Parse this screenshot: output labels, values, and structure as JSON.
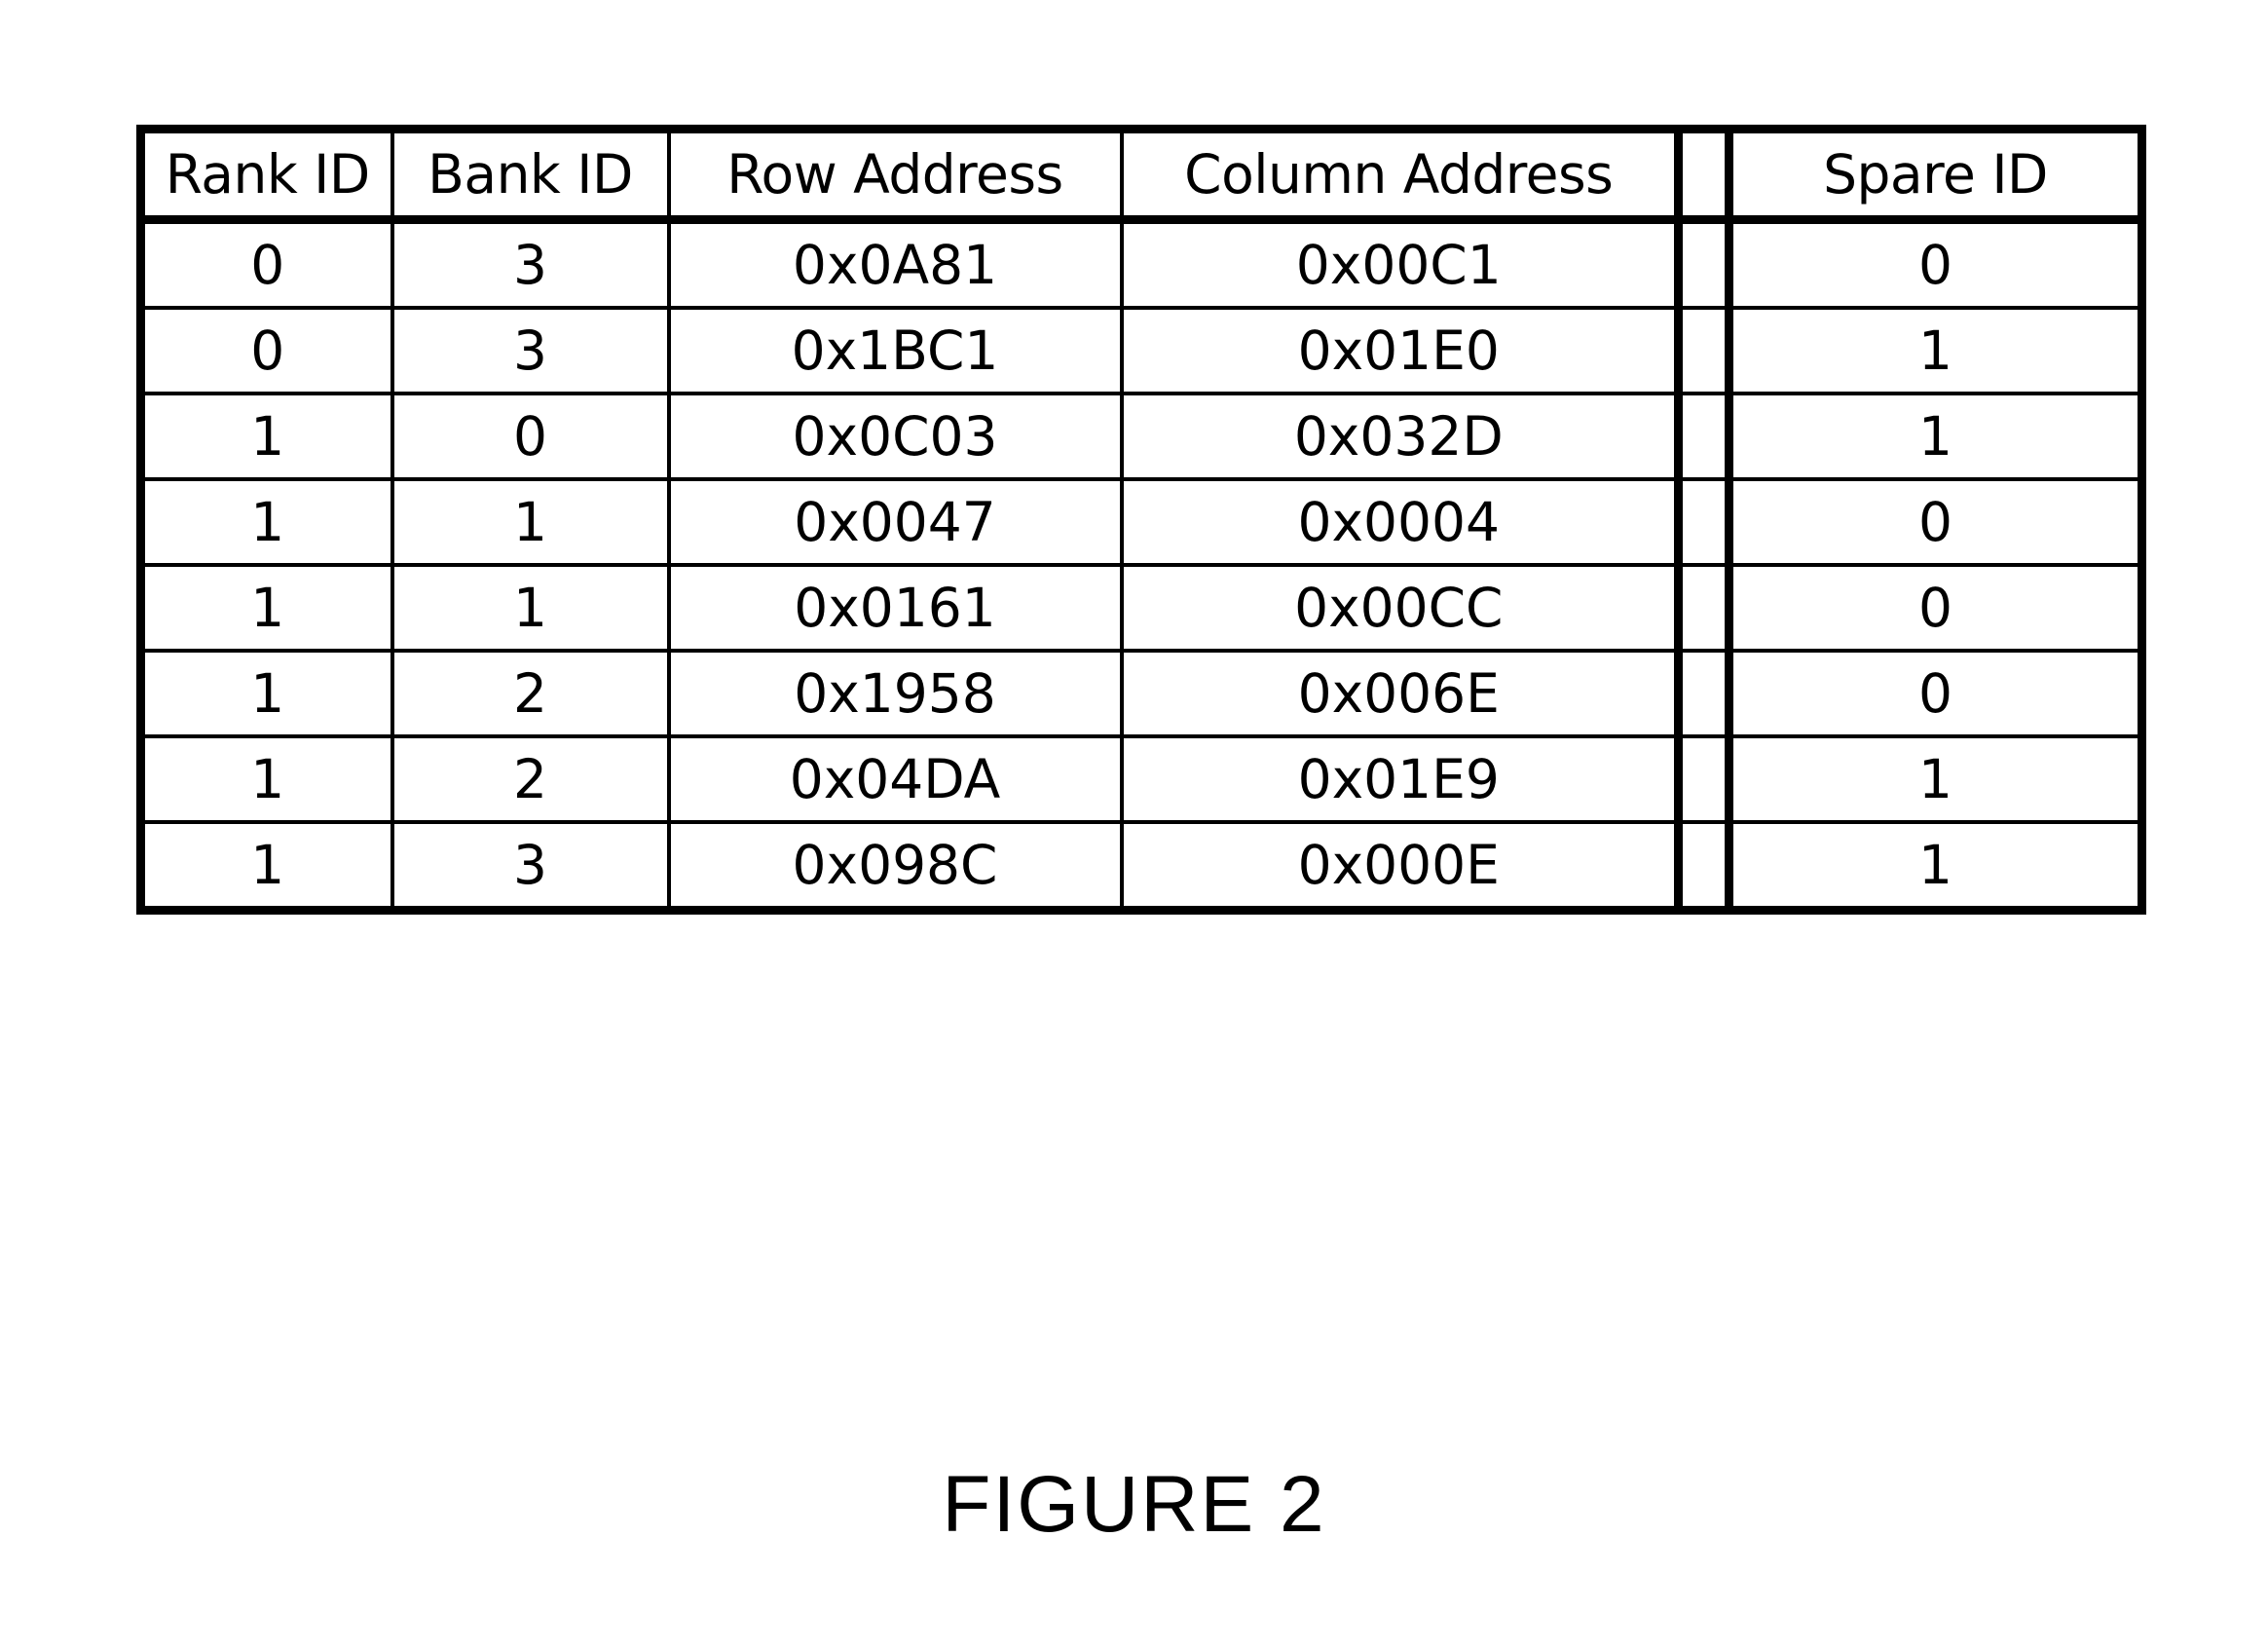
{
  "figure": {
    "caption": "FIGURE 2"
  },
  "table": {
    "headers": {
      "rank_id": "Rank ID",
      "bank_id": "Bank ID",
      "row_address": "Row Address",
      "column_address": "Column Address",
      "gap": "",
      "spare_id": "Spare ID"
    },
    "columns": [
      "Rank ID",
      "Bank ID",
      "Row Address",
      "Column Address",
      "",
      "Spare ID"
    ],
    "rows": [
      {
        "rank_id": "0",
        "bank_id": "3",
        "row_address": "0x0A81",
        "column_address": "0x00C1",
        "gap": "",
        "spare_id": "0"
      },
      {
        "rank_id": "0",
        "bank_id": "3",
        "row_address": "0x1BC1",
        "column_address": "0x01E0",
        "gap": "",
        "spare_id": "1"
      },
      {
        "rank_id": "1",
        "bank_id": "0",
        "row_address": "0x0C03",
        "column_address": "0x032D",
        "gap": "",
        "spare_id": "1"
      },
      {
        "rank_id": "1",
        "bank_id": "1",
        "row_address": "0x0047",
        "column_address": "0x0004",
        "gap": "",
        "spare_id": "0"
      },
      {
        "rank_id": "1",
        "bank_id": "1",
        "row_address": "0x0161",
        "column_address": "0x00CC",
        "gap": "",
        "spare_id": "0"
      },
      {
        "rank_id": "1",
        "bank_id": "2",
        "row_address": "0x1958",
        "column_address": "0x006E",
        "gap": "",
        "spare_id": "0"
      },
      {
        "rank_id": "1",
        "bank_id": "2",
        "row_address": "0x04DA",
        "column_address": "0x01E9",
        "gap": "",
        "spare_id": "1"
      },
      {
        "rank_id": "1",
        "bank_id": "3",
        "row_address": "0x098C",
        "column_address": "0x000E",
        "gap": "",
        "spare_id": "1"
      }
    ]
  },
  "colors": {
    "ink": "#000000",
    "paper": "#ffffff"
  }
}
